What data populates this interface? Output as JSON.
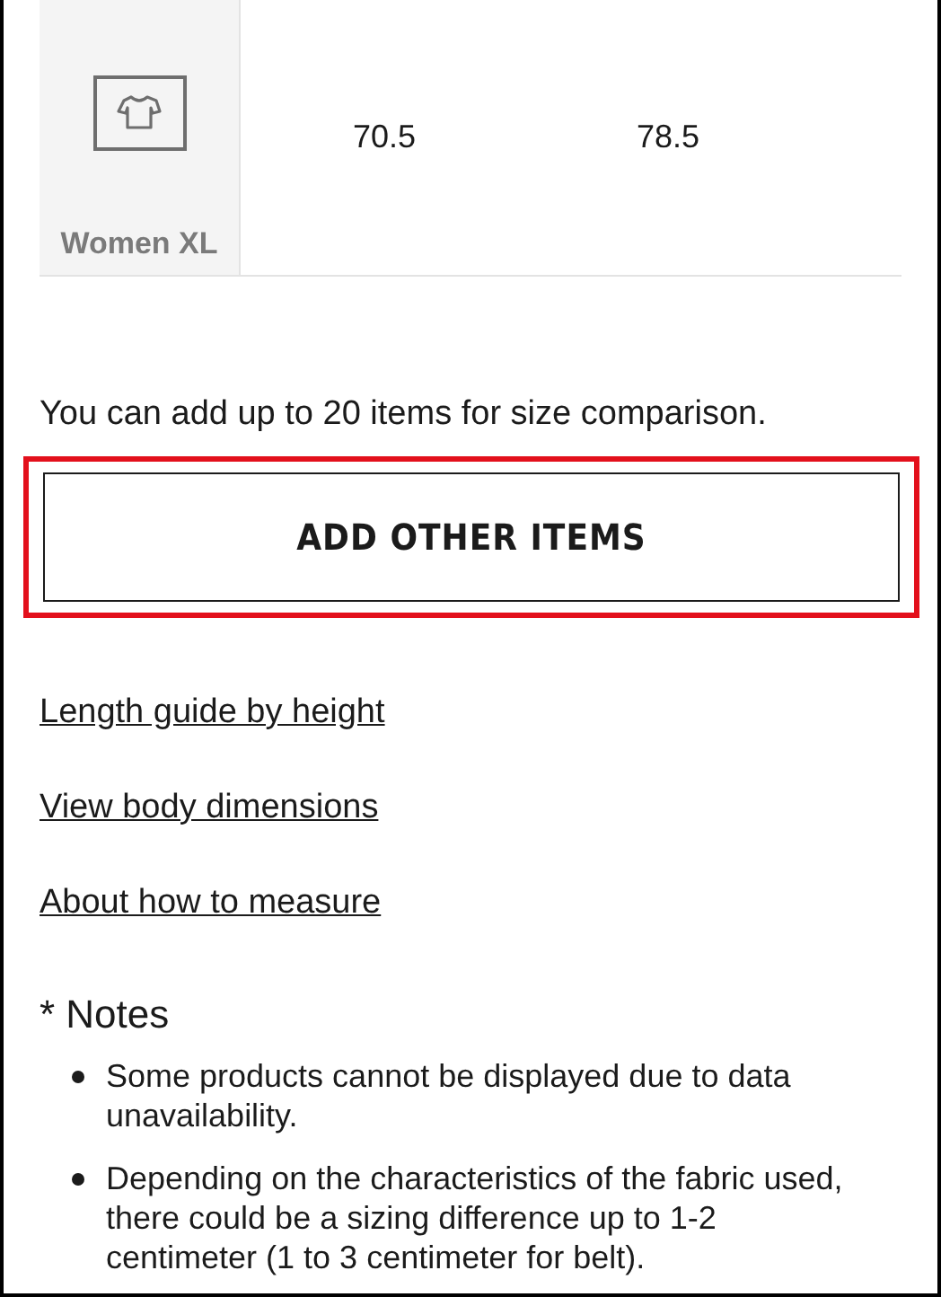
{
  "size_table": {
    "rows": [
      {
        "label": "Women XL",
        "values": [
          "70.5",
          "78.5"
        ]
      }
    ]
  },
  "comparison_note": "You can add up to 20 items for size comparison.",
  "add_button": {
    "label": "ADD OTHER ITEMS",
    "highlighted": true
  },
  "links": [
    "Length guide by height",
    "View body dimensions",
    "About how to measure"
  ],
  "notes": {
    "heading": "* Notes",
    "items": [
      "Some products cannot be displayed due to data unavailability.",
      "Depending on the characteristics of the fabric used, there could be a sizing difference up to 1-2 centimeter (1 to 3 centimeter for belt)."
    ]
  }
}
